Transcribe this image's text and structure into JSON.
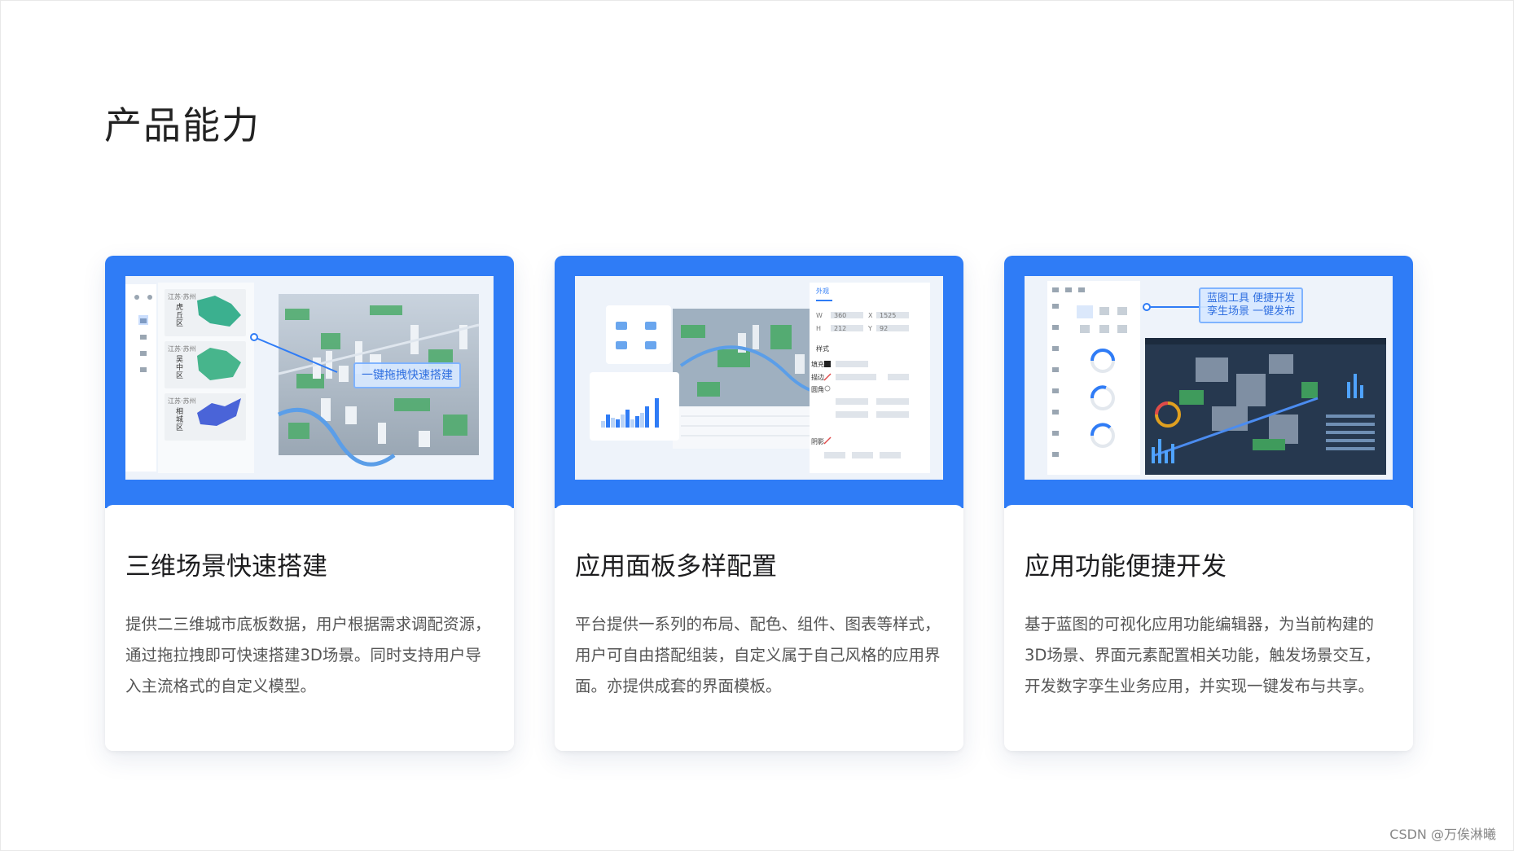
{
  "page": {
    "title": "产品能力",
    "watermark": "CSDN @万俟淋曦"
  },
  "colors": {
    "accent": "#2f7cf6",
    "title_text": "#1d1d1f",
    "body_text": "#555555"
  },
  "cards": [
    {
      "title": "三维场景快速搭建",
      "description": "提供二三维城市底板数据，用户根据需求调配资源，通过拖拉拽即可快速搭建3D场景。同时支持用户导入主流格式的自定义模型。",
      "screenshot": {
        "callout": "一键拖拽快速搭建",
        "districts": [
          {
            "region": "江苏·苏州",
            "name": "虎丘区"
          },
          {
            "region": "江苏·苏州",
            "name": "吴中区"
          },
          {
            "region": "江苏·苏州",
            "name": "相城区"
          }
        ]
      }
    },
    {
      "title": "应用面板多样配置",
      "description": "平台提供一系列的布局、配色、组件、图表等样式，用户可自由搭配组装，自定义属于自己风格的应用界面。亦提供成套的界面模板。",
      "screenshot": {
        "tab_label": "外观",
        "style_label": "样式",
        "fill_label": "填充",
        "stroke_label": "描边",
        "radius_label": "圆角",
        "shadow_label": "阴影",
        "w_label": "W",
        "w_value": "360",
        "h_label": "H",
        "h_value": "212",
        "x_label": "X",
        "x_value": "1525",
        "y_label": "Y",
        "y_value": "92"
      }
    },
    {
      "title": "应用功能便捷开发",
      "description": "基于蓝图的可视化应用功能编辑器，为当前构建的3D场景、界面元素配置相关功能，触发场景交互，开发数字孪生业务应用，并实现一键发布与共享。",
      "screenshot": {
        "callout_line1": "蓝图工具 便捷开发",
        "callout_line2": "孪生场景 一键发布"
      }
    }
  ]
}
